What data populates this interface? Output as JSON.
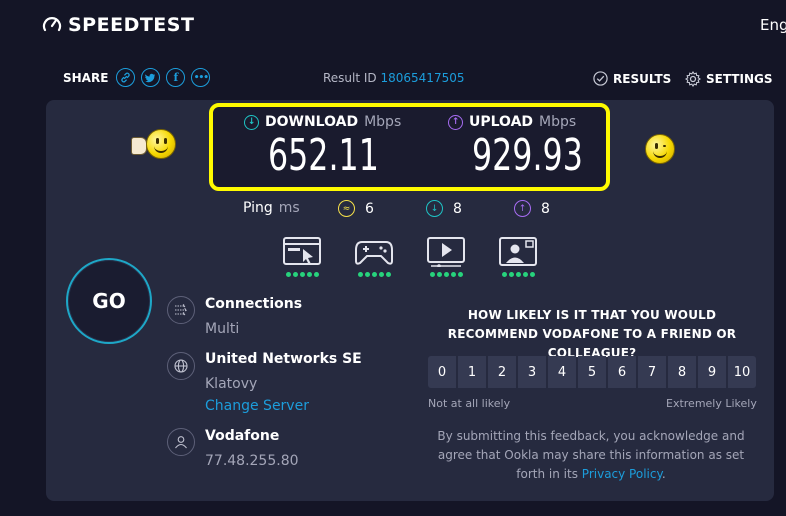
{
  "header": {
    "brand": "SPEEDTEST",
    "language": "Eng"
  },
  "share": {
    "label": "SHARE",
    "buttons": [
      "link-icon",
      "twitter-icon",
      "facebook-icon",
      "more-icon"
    ]
  },
  "result": {
    "label": "Result ID",
    "id": "18065417505"
  },
  "nav": {
    "results": "RESULTS",
    "settings": "SETTINGS"
  },
  "download": {
    "label": "DOWNLOAD",
    "unit": "Mbps",
    "value": "652.11"
  },
  "upload": {
    "label": "UPLOAD",
    "unit": "Mbps",
    "value": "929.93"
  },
  "ping": {
    "label": "Ping",
    "unit": "ms",
    "idle": "6",
    "download": "8",
    "upload": "8"
  },
  "experience_icons": [
    "web-browsing-icon",
    "gaming-icon",
    "video-streaming-icon",
    "video-call-icon"
  ],
  "go_label": "GO",
  "connections": {
    "title": "Connections",
    "value": "Multi"
  },
  "server": {
    "title": "United Networks SE",
    "location": "Klatovy",
    "change": "Change Server"
  },
  "provider": {
    "title": "Vodafone",
    "ip": "77.48.255.80"
  },
  "survey": {
    "question": "HOW LIKELY IS IT THAT YOU WOULD RECOMMEND VODAFONE TO A FRIEND OR COLLEAGUE?",
    "scale": [
      "0",
      "1",
      "2",
      "3",
      "4",
      "5",
      "6",
      "7",
      "8",
      "9",
      "10"
    ],
    "low_label": "Not at all likely",
    "high_label": "Extremely Likely",
    "disclaimer_prefix": "By submitting this feedback, you acknowledge and agree that Ookla may share this information as set forth in its",
    "policy_link": "Privacy Policy",
    "disclaimer_suffix": "."
  },
  "colors": {
    "accent": "#1c9ddb",
    "download": "#1ec3c5",
    "upload": "#a66cf2",
    "highlight": "#fffb00",
    "good": "#27d37c"
  }
}
